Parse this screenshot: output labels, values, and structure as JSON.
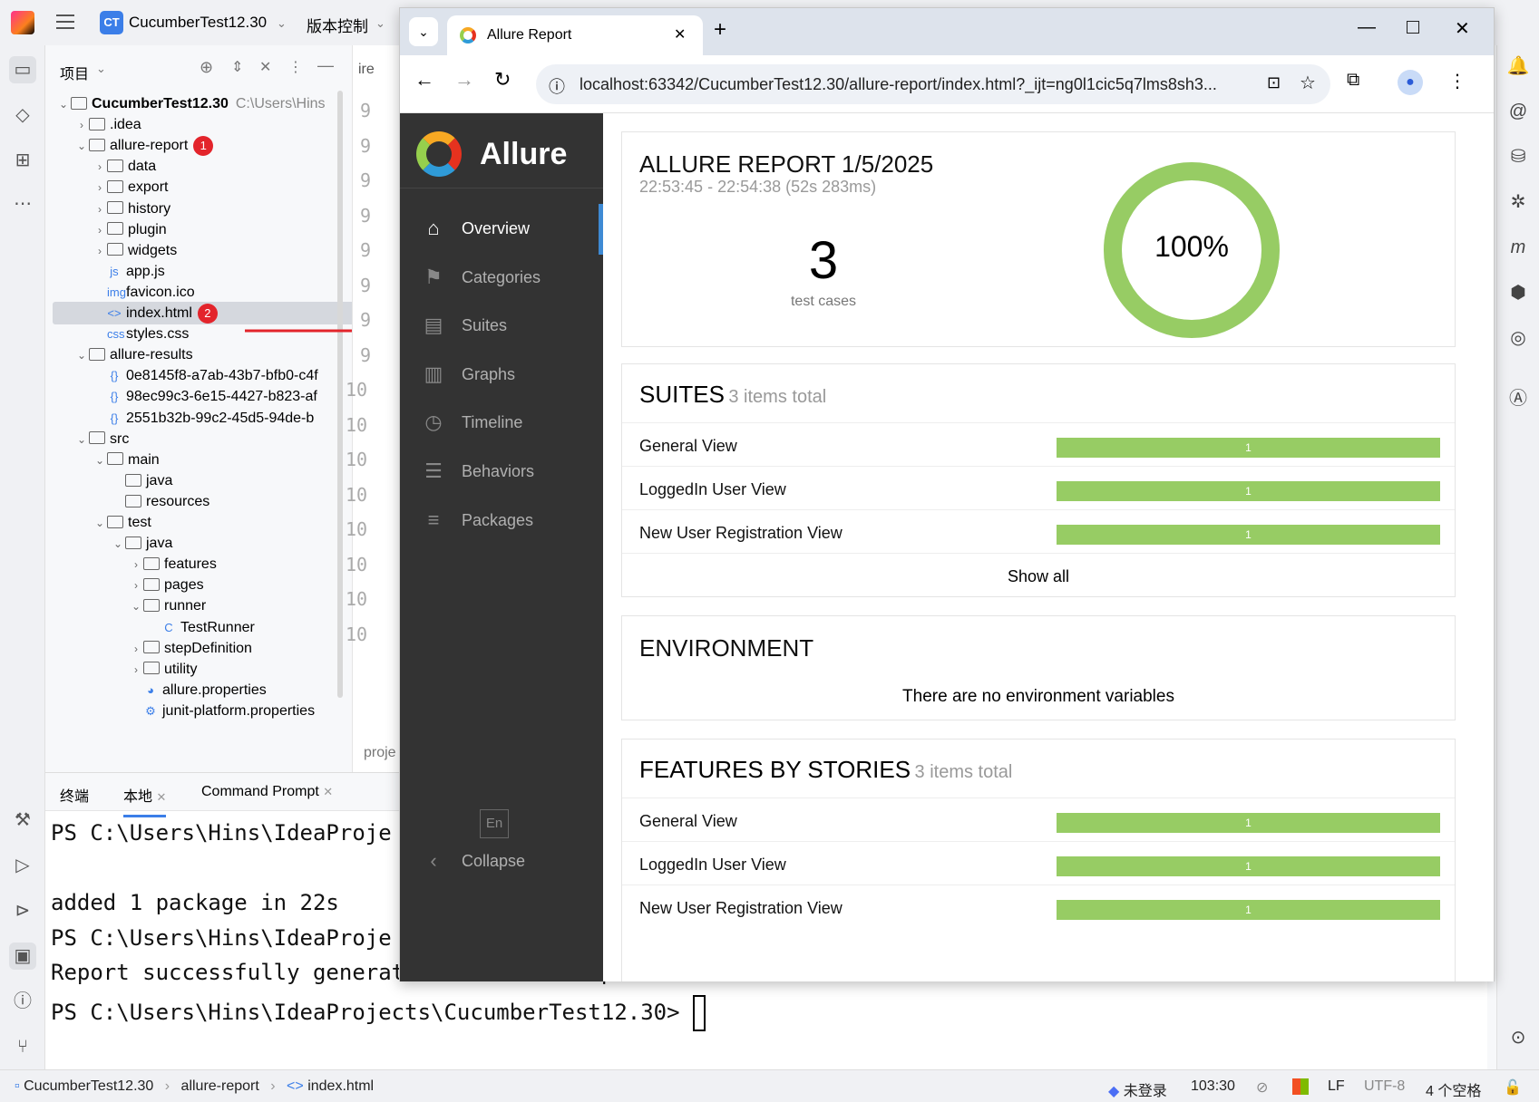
{
  "ide": {
    "project_name": "CucumberTest12.30",
    "vcs_label": "版本控制",
    "project_panel_title": "项目",
    "tree": [
      {
        "depth": 0,
        "label": "CucumberTest12.30",
        "extra": "C:\\Users\\Hins",
        "arrow": "⌄",
        "kind": "folder"
      },
      {
        "depth": 1,
        "label": ".idea",
        "arrow": "›",
        "kind": "folder"
      },
      {
        "depth": 1,
        "label": "allure-report",
        "arrow": "⌄",
        "kind": "folder",
        "badge": "1"
      },
      {
        "depth": 2,
        "label": "data",
        "arrow": "›",
        "kind": "folder"
      },
      {
        "depth": 2,
        "label": "export",
        "arrow": "›",
        "kind": "folder"
      },
      {
        "depth": 2,
        "label": "history",
        "arrow": "›",
        "kind": "folder"
      },
      {
        "depth": 2,
        "label": "plugin",
        "arrow": "›",
        "kind": "folder"
      },
      {
        "depth": 2,
        "label": "widgets",
        "arrow": "›",
        "kind": "folder"
      },
      {
        "depth": 2,
        "label": "app.js",
        "arrow": "",
        "kind": "file",
        "icon": "js"
      },
      {
        "depth": 2,
        "label": "favicon.ico",
        "arrow": "",
        "kind": "file",
        "icon": "img"
      },
      {
        "depth": 2,
        "label": "index.html",
        "arrow": "",
        "kind": "file",
        "icon": "<>",
        "badge": "2",
        "selected": true
      },
      {
        "depth": 2,
        "label": "styles.css",
        "arrow": "",
        "kind": "file",
        "icon": "css"
      },
      {
        "depth": 1,
        "label": "allure-results",
        "arrow": "⌄",
        "kind": "folder"
      },
      {
        "depth": 2,
        "label": "0e8145f8-a7ab-43b7-bfb0-c4f",
        "arrow": "",
        "kind": "file",
        "icon": "{}"
      },
      {
        "depth": 2,
        "label": "98ec99c3-6e15-4427-b823-af",
        "arrow": "",
        "kind": "file",
        "icon": "{}"
      },
      {
        "depth": 2,
        "label": "2551b32b-99c2-45d5-94de-b",
        "arrow": "",
        "kind": "file",
        "icon": "{}"
      },
      {
        "depth": 1,
        "label": "src",
        "arrow": "⌄",
        "kind": "folder"
      },
      {
        "depth": 2,
        "label": "main",
        "arrow": "⌄",
        "kind": "folder"
      },
      {
        "depth": 3,
        "label": "java",
        "arrow": "",
        "kind": "folder"
      },
      {
        "depth": 3,
        "label": "resources",
        "arrow": "",
        "kind": "folder"
      },
      {
        "depth": 2,
        "label": "test",
        "arrow": "⌄",
        "kind": "folder"
      },
      {
        "depth": 3,
        "label": "java",
        "arrow": "⌄",
        "kind": "folder"
      },
      {
        "depth": 4,
        "label": "features",
        "arrow": "›",
        "kind": "folder"
      },
      {
        "depth": 4,
        "label": "pages",
        "arrow": "›",
        "kind": "folder"
      },
      {
        "depth": 4,
        "label": "runner",
        "arrow": "⌄",
        "kind": "folder"
      },
      {
        "depth": 5,
        "label": "TestRunner",
        "arrow": "",
        "kind": "file",
        "icon": "C"
      },
      {
        "depth": 4,
        "label": "stepDefinition",
        "arrow": "›",
        "kind": "folder"
      },
      {
        "depth": 4,
        "label": "utility",
        "arrow": "›",
        "kind": "folder"
      },
      {
        "depth": 4,
        "label": "allure.properties",
        "arrow": "",
        "kind": "file",
        "icon": "◕"
      },
      {
        "depth": 4,
        "label": "junit-platform.properties",
        "arrow": "",
        "kind": "file",
        "icon": "⚙"
      }
    ],
    "editor_tab_fragment": "ire",
    "editor_footer_fragment": "proje",
    "gutter": [
      "9",
      "9",
      "9",
      "9",
      "9",
      "9",
      "9",
      "9",
      "10",
      "10",
      "10",
      "10",
      "10",
      "10",
      "10",
      "10"
    ],
    "terminal": {
      "tabs": [
        "终端",
        "本地",
        "Command Prompt"
      ],
      "lines": [
        "PS C:\\Users\\Hins\\IdeaProje",
        "",
        "added 1 package in 22s",
        "PS C:\\Users\\Hins\\IdeaProje",
        "Report successfully generated to allure-report",
        "PS C:\\Users\\Hins\\IdeaProjects\\CucumberTest12.30> "
      ]
    },
    "status": {
      "breadcrumb": [
        "CucumberTest12.30",
        "allure-report",
        "index.html"
      ],
      "login": "未登录",
      "position": "103:30",
      "line_sep": "LF",
      "encoding": "UTF-8",
      "indent": "4 个空格"
    }
  },
  "browser": {
    "tab_title": "Allure Report",
    "url": "localhost:63342/CucumberTest12.30/allure-report/index.html?_ijt=ng0l1cic5q7lms8sh3..."
  },
  "allure": {
    "brand": "Allure",
    "nav": [
      {
        "label": "Overview",
        "icon": "home-icon",
        "glyph": "⌂",
        "active": true
      },
      {
        "label": "Categories",
        "icon": "flag-icon",
        "glyph": "⚑"
      },
      {
        "label": "Suites",
        "icon": "briefcase-icon",
        "glyph": "▤"
      },
      {
        "label": "Graphs",
        "icon": "bar-chart-icon",
        "glyph": "▥"
      },
      {
        "label": "Timeline",
        "icon": "clock-icon",
        "glyph": "◷"
      },
      {
        "label": "Behaviors",
        "icon": "list-icon",
        "glyph": "☰"
      },
      {
        "label": "Packages",
        "icon": "packages-icon",
        "glyph": "≡"
      }
    ],
    "lang": "En",
    "collapse": "Collapse",
    "report_title": "ALLURE REPORT 1/5/2025",
    "report_time": "22:53:45 - 22:54:38 (52s 283ms)",
    "test_count": "3",
    "test_count_label": "test cases",
    "pass_percent": "100%",
    "pass_fraction": 1.0,
    "suites": {
      "title": "SUITES",
      "total": "3 items total",
      "rows": [
        {
          "name": "General View",
          "count": "1"
        },
        {
          "name": "LoggedIn User View",
          "count": "1"
        },
        {
          "name": "New User Registration View",
          "count": "1"
        }
      ],
      "show_all": "Show all"
    },
    "environment": {
      "title": "ENVIRONMENT",
      "empty": "There are no environment variables"
    },
    "features": {
      "title": "FEATURES BY STORIES",
      "total": "3 items total",
      "rows": [
        {
          "name": "General View",
          "count": "1"
        },
        {
          "name": "LoggedIn User View",
          "count": "1"
        },
        {
          "name": "New User Registration View",
          "count": "1"
        }
      ]
    },
    "colors": {
      "passed": "#97cc64",
      "sidebar": "#333333",
      "accent": "#3e8ad4"
    }
  }
}
